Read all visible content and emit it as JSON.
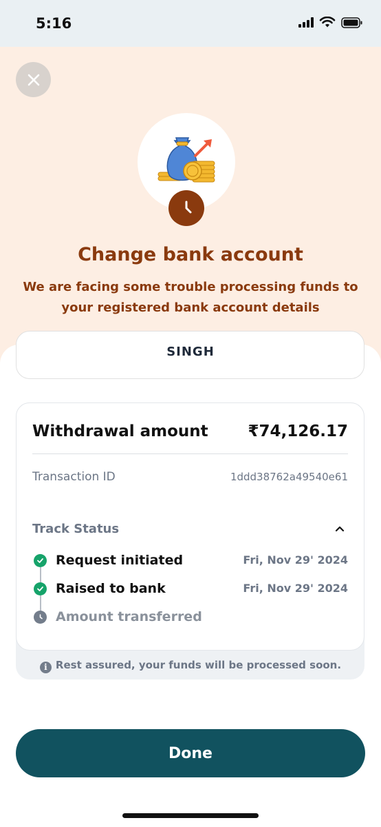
{
  "status_bar": {
    "time": "5:16",
    "icons": [
      "signal-icon",
      "wifi-icon",
      "battery-icon"
    ]
  },
  "header": {
    "close_icon": "close-icon",
    "hero_icon": "money-bag-growth-icon",
    "badge_icon": "clock-icon",
    "title": "Change bank account",
    "subtitle": "We are facing some trouble processing funds to your registered bank account details"
  },
  "account": {
    "name": "SINGH"
  },
  "transaction": {
    "withdrawal_label": "Withdrawal amount",
    "withdrawal_value": "₹74,126.17",
    "txn_label": "Transaction ID",
    "txn_value": "1ddd38762a49540e61"
  },
  "track": {
    "label": "Track Status",
    "steps": [
      {
        "label": "Request initiated",
        "date": "Fri, Nov 29' 2024",
        "status": "done"
      },
      {
        "label": "Raised to bank",
        "date": "Fri, Nov 29' 2024",
        "status": "done"
      },
      {
        "label": "Amount transferred",
        "date": "",
        "status": "pending"
      }
    ]
  },
  "note": "Rest assured, your funds will be processed soon.",
  "done_label": "Done",
  "colors": {
    "brand_brown": "#8a3a0e",
    "header_bg": "#fdeee3",
    "button": "#11525f",
    "success": "#16a36a"
  }
}
